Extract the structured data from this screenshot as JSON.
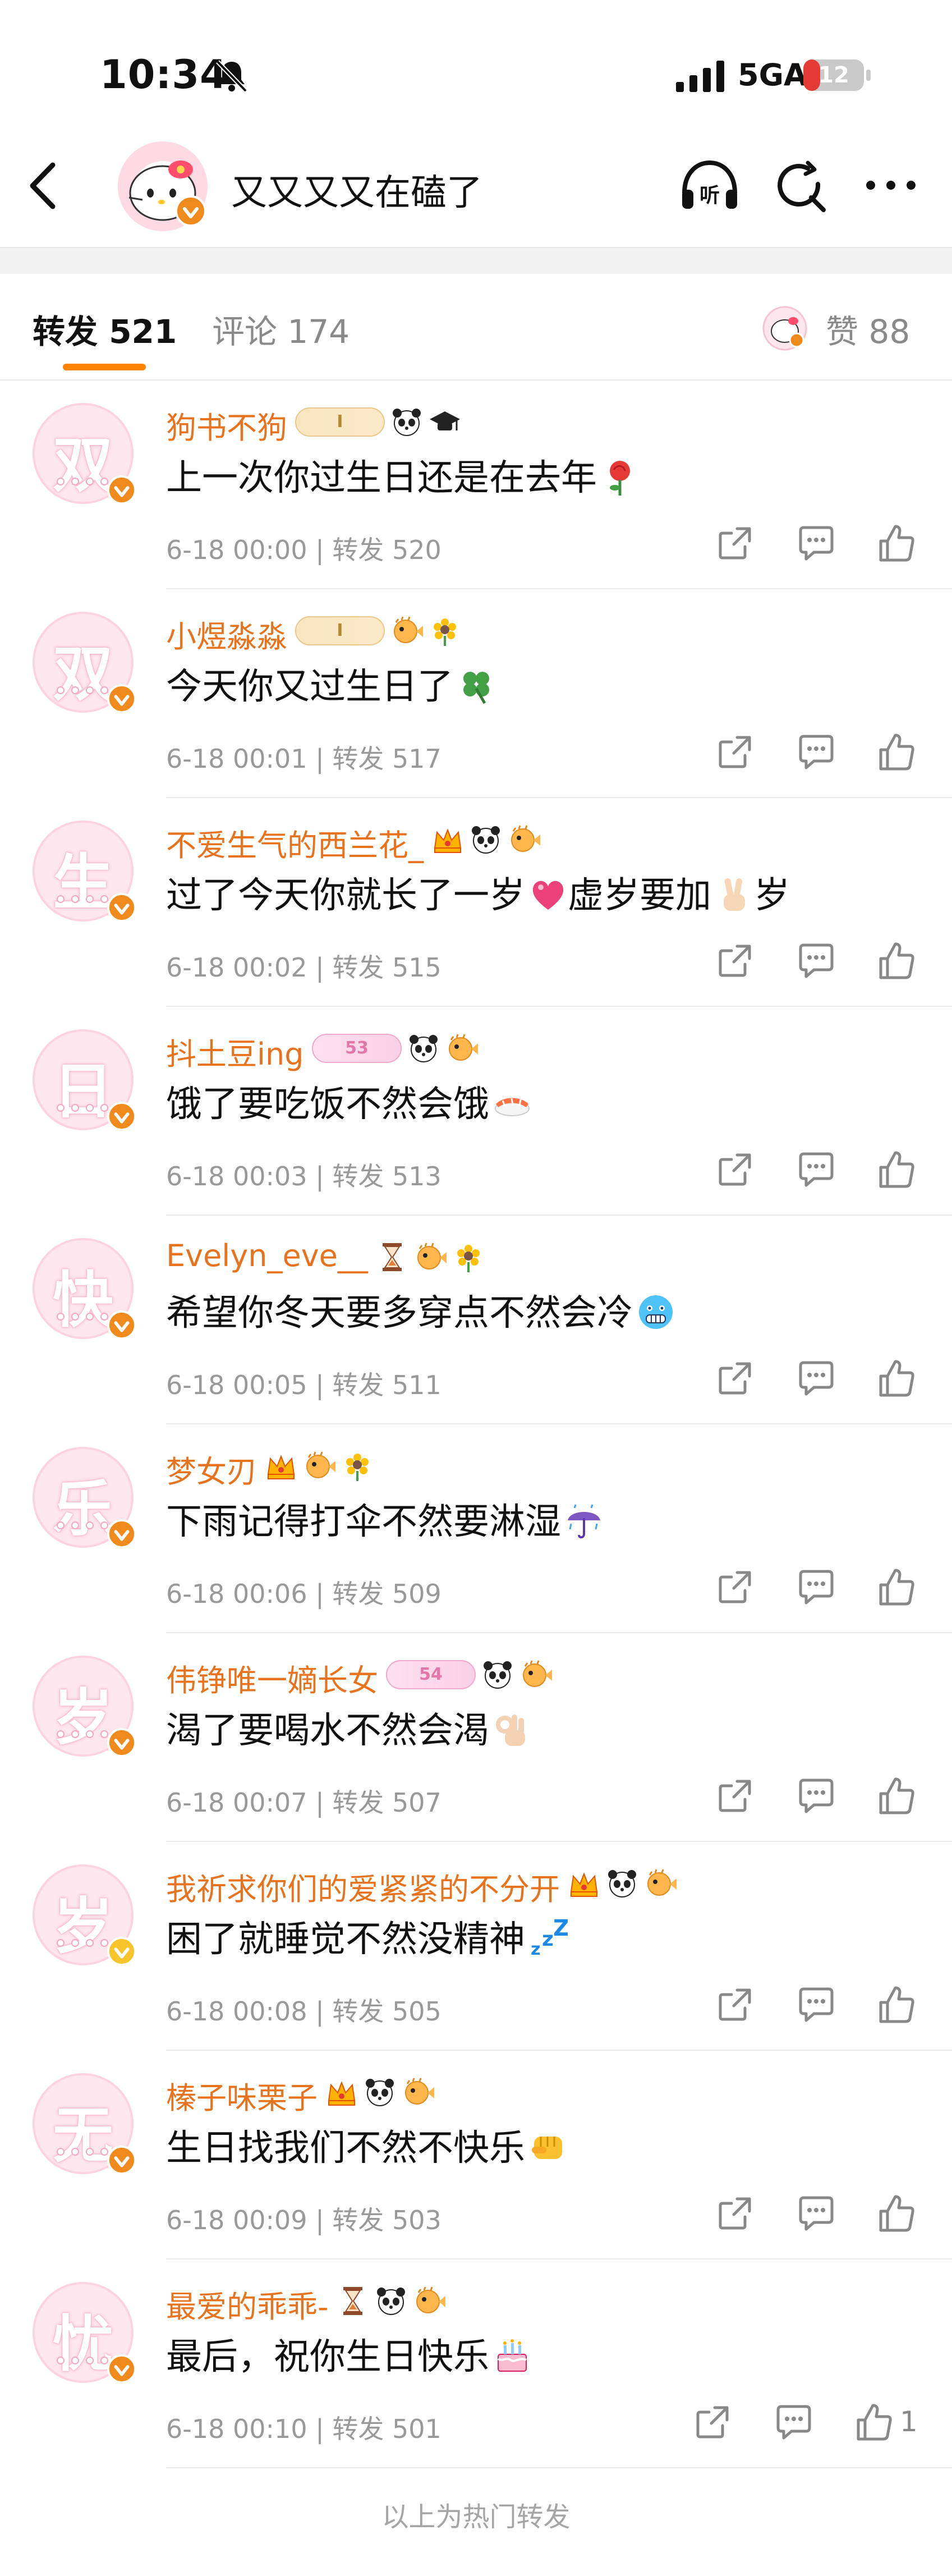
{
  "status_bar": {
    "time": "10:34",
    "network": "5GA",
    "battery": "12"
  },
  "header": {
    "title": "又又又又在磕了"
  },
  "tabs": {
    "repost": "转发 521",
    "comment": "评论 174",
    "likes": "赞 88"
  },
  "rows": [
    {
      "name": "狗书不狗",
      "text": "上一次你过生日还是在去年",
      "time": "6-18 00:00",
      "repost": "转发 520",
      "glyph": "双",
      "badge": "I",
      "badge_style": "gold",
      "icons": [
        "panda-icon",
        "graduation-cap-icon"
      ],
      "emoji": "rose-icon"
    },
    {
      "name": "小煜淼淼",
      "text": "今天你又过生日了",
      "time": "6-18 00:01",
      "repost": "转发 517",
      "glyph": "双",
      "badge": "I",
      "badge_style": "gold",
      "icons": [
        "pufferfish-icon",
        "sunflower-icon"
      ],
      "emoji": "clover-icon"
    },
    {
      "name": "不爱生气的西兰花_",
      "text": "过了今天你就长了一岁",
      "text2": "虚岁要加",
      "text3": "岁",
      "time": "6-18 00:02",
      "repost": "转发 515",
      "glyph": "生",
      "badge": "",
      "badge_style": "",
      "icons": [
        "crown-icon",
        "panda-icon",
        "pufferfish-icon"
      ],
      "emoji": "pink-heart-icon",
      "emoji2": "victory-hand-icon"
    },
    {
      "name": "抖土豆ing",
      "text": "饿了要吃饭不然会饿",
      "time": "6-18 00:03",
      "repost": "转发 513",
      "glyph": "日",
      "badge": "53",
      "badge_style": "pink",
      "icons": [
        "panda-icon",
        "pufferfish-icon"
      ],
      "emoji": "sushi-icon"
    },
    {
      "name": "Evelyn_eve__",
      "text": "希望你冬天要多穿点不然会冷",
      "time": "6-18 00:05",
      "repost": "转发 511",
      "glyph": "快",
      "badge": "",
      "badge_style": "",
      "icons": [
        "hourglass-icon",
        "pufferfish-icon",
        "sunflower-icon"
      ],
      "emoji": "cold-face-icon"
    },
    {
      "name": "梦女刃",
      "text": "下雨记得打伞不然要淋湿",
      "time": "6-18 00:06",
      "repost": "转发 509",
      "glyph": "乐",
      "badge": "",
      "badge_style": "",
      "icons": [
        "crown-icon",
        "pufferfish-icon",
        "sunflower-icon"
      ],
      "emoji": "umbrella-rain-icon"
    },
    {
      "name": "伟铮唯一嫡长女",
      "text": "渴了要喝水不然会渴",
      "time": "6-18 00:07",
      "repost": "转发 507",
      "glyph": "岁",
      "badge": "54",
      "badge_style": "pink",
      "icons": [
        "panda-icon",
        "pufferfish-icon"
      ],
      "emoji": "ok-hand-icon"
    },
    {
      "name": "我祈求你们的爱紧紧的不分开",
      "text": "困了就睡觉不然没精神",
      "time": "6-18 00:08",
      "repost": "转发 505",
      "glyph": "岁",
      "badge": "",
      "badge_style": "",
      "icons": [
        "crown-icon",
        "panda-icon",
        "pufferfish-icon"
      ],
      "emoji": "zzz-icon",
      "v_gold": true
    },
    {
      "name": "榛子味栗子",
      "text": "生日找我们不然不快乐",
      "time": "6-18 00:09",
      "repost": "转发 503",
      "glyph": "无",
      "badge": "",
      "badge_style": "",
      "icons": [
        "crown-icon",
        "panda-icon",
        "pufferfish-icon"
      ],
      "emoji": "fist-icon"
    },
    {
      "name": "最爱的乖乖-",
      "text": "最后，祝你生日快乐",
      "time": "6-18 00:10",
      "repost": "转发 501",
      "glyph": "忧",
      "badge": "",
      "badge_style": "",
      "icons": [
        "hourglass-icon",
        "panda-icon",
        "pufferfish-icon"
      ],
      "emoji": "birthday-cake-icon",
      "like_count": "1"
    }
  ],
  "footer": {
    "note": "以上为热门转发"
  },
  "colors": {
    "accent": "#ff8200",
    "username": "#e8731f",
    "verified": "#f08a1c"
  }
}
